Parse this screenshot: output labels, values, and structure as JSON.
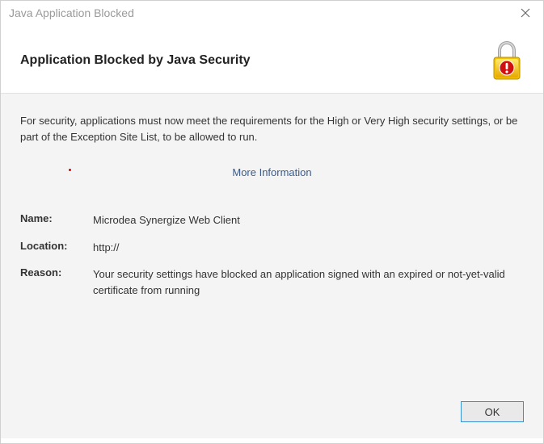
{
  "titlebar": {
    "text": "Java Application Blocked"
  },
  "header": {
    "title": "Application Blocked by Java Security"
  },
  "content": {
    "intro": "For security, applications must now meet the requirements for the High or Very High security settings, or be part of the Exception Site List, to be allowed to run.",
    "more_info": "More Information",
    "labels": {
      "name": "Name:",
      "location": "Location:",
      "reason": "Reason:"
    },
    "values": {
      "name": "Microdea Synergize Web Client",
      "location": "http://",
      "reason": "Your security settings have blocked an application signed with an expired or not-yet-valid certificate from running"
    }
  },
  "buttons": {
    "ok": "OK"
  }
}
